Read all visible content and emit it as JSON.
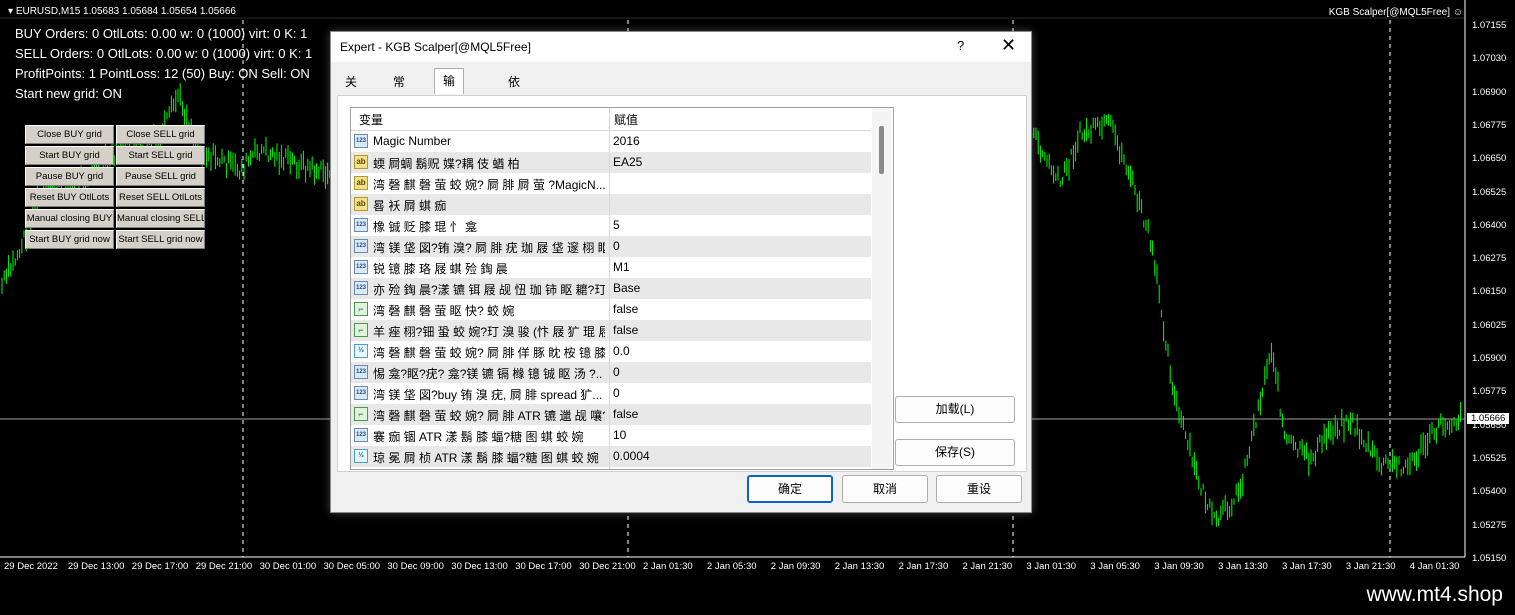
{
  "chart": {
    "symbol_line": "EURUSD,M15  1.05683 1.05684 1.05654 1.05666",
    "ea_badge": "KGB Scalper[@MQL5Free]",
    "smile_icon": "smile-icon",
    "info_lines": [
      "BUY  Orders: 0  OtlLots: 0.00  w: 0 (1000)  virt: 0  K: 1",
      "SELL Orders: 0  OtlLots: 0.00  w: 0 (1000)  virt: 0  K: 1",
      "ProfitPoints: 1  PointLoss: 12 (50) Buy: ON Sell: ON",
      "Start new grid: ON"
    ],
    "grid_buttons": [
      [
        "Close BUY grid",
        "Close SELL grid"
      ],
      [
        "Start BUY grid",
        "Start SELL grid"
      ],
      [
        "Pause BUY grid",
        "Pause SELL grid"
      ],
      [
        "Reset BUY OtlLots",
        "Reset SELL OtlLots"
      ],
      [
        "Manual closing BUY",
        "Manual closing SELL"
      ],
      [
        "Start BUY grid now",
        "Start SELL grid now"
      ]
    ],
    "price_labels": [
      "1.07155",
      "1.07030",
      "1.06900",
      "1.06775",
      "1.06650",
      "1.06525",
      "1.06400",
      "1.06275",
      "1.06150",
      "1.06025",
      "1.05900",
      "1.05775",
      "1.05650",
      "1.05525",
      "1.05400",
      "1.05275",
      "1.05150"
    ],
    "current_price": "1.05666",
    "time_labels": [
      "29 Dec 2022",
      "29 Dec 13:00",
      "29 Dec 17:00",
      "29 Dec 21:00",
      "30 Dec 01:00",
      "30 Dec 05:00",
      "30 Dec 09:00",
      "30 Dec 13:00",
      "30 Dec 17:00",
      "30 Dec 21:00",
      "2 Jan 01:30",
      "2 Jan 05:30",
      "2 Jan 09:30",
      "2 Jan 13:30",
      "2 Jan 17:30",
      "2 Jan 21:30",
      "3 Jan 01:30",
      "3 Jan 05:30",
      "3 Jan 09:30",
      "3 Jan 13:30",
      "3 Jan 17:30",
      "3 Jan 21:30",
      "4 Jan 01:30"
    ],
    "up_color": "#00ff00",
    "bg_color": "#000000"
  },
  "dialog": {
    "title": "Expert - KGB Scalper[@MQL5Free]",
    "help": "?",
    "close": "✕",
    "tabs": [
      "关于",
      "常用",
      "输入参数",
      "依存关系"
    ],
    "active_tab": 2,
    "columns": [
      "变量",
      "赋值"
    ],
    "rows": [
      {
        "icon": "123",
        "name": "Magic Number",
        "value": "2016"
      },
      {
        "icon": "ab",
        "name": "蝡 屙蜩 鬍贶 媟?耦 伎 蝤 柏",
        "value": "EA25"
      },
      {
        "icon": "ab",
        "name": "湾 磬 麒 磬 萤  蛟 婉? 屙 腓  屙 萤     ?MagicN...",
        "value": ""
      },
      {
        "icon": "ab",
        "name": "晷 袄 屙 蜞 痂",
        "value": ""
      },
      {
        "icon": "123",
        "name": "橡 铖 贬 膝 琨 忄  龛",
        "value": "5"
      },
      {
        "icon": "123",
        "name": "湾  镁 垡    図?铕 溴? 屙 腓  疣 珈 屐  垡 邃 栩 眍?..",
        "value": "0"
      },
      {
        "icon": "123",
        "name": "锐 镱 膝 珞 屐      蜞 殓 鋾 晨",
        "value": "M1"
      },
      {
        "icon": "123",
        "name": "亦 殓 鋾 晨?漾     镳 铒 屐 觇  忸 珈 铈 眍 耱?玎?..",
        "value": "Base"
      },
      {
        "icon": "bool",
        "name": "湾 磬 麒 磬 萤  眍 快? 蛟 婉",
        "value": "false"
      },
      {
        "icon": "bool",
        "name": "羊 痤 栩?钿 蛩  蛟 婉?玎  溴 骏  (忭 屐     犷 琨 屐?",
        "value": "false"
      },
      {
        "icon": "half",
        "name": "湾 磬 麒 磬 萤  蛟 婉? 屙 腓  佯 豚 眈  桉 镱 膝 珞?..",
        "value": "0.0"
      },
      {
        "icon": "123",
        "name": "惕 龛?眍?疣?     龛?镁  镳 镉 橼 镱 铖 眍 汤  ?..",
        "value": "0"
      },
      {
        "icon": "123",
        "name": "湾  镁 垡    図?buy 铕 溴 疣, 屙 腓 spread 犷...",
        "value": "0"
      },
      {
        "icon": "bool",
        "name": "湾 磬 麒 磬 萤  蛟 婉? 屙 腓 ATR 镳 邋 觇   嚷?玎...",
        "value": "false"
      },
      {
        "icon": "123",
        "name": "褰 痂 锢 ATR 漾      鬍 膝 蝠?糖 图 蜞  蛟 婉",
        "value": "10"
      },
      {
        "icon": "half",
        "name": "琼 冕 屙 桢 ATR 漾      鬍 膝 蝠?糖 图 蜞  蛟 婉",
        "value": "0.0004"
      }
    ],
    "load_button": "加载(L)",
    "save_button": "保存(S)",
    "ok_button": "确定",
    "cancel_button": "取消",
    "reset_button": "重设"
  },
  "footer": {
    "brand": "www.mt4.shop"
  }
}
